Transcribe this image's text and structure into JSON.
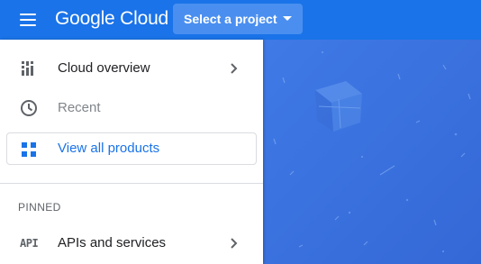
{
  "topbar": {
    "brand_google": "Google",
    "brand_cloud": "Cloud",
    "project_picker_label": "Select a project",
    "background_color": "#1a73e8"
  },
  "sidenav": {
    "items": [
      {
        "label": "Cloud overview",
        "icon": "dashboard-icon",
        "has_chevron": true
      },
      {
        "label": "Recent",
        "icon": "clock-icon",
        "has_chevron": false
      }
    ],
    "view_all": {
      "label": "View all products",
      "icon": "grid-icon"
    },
    "pinned_header": "PINNED",
    "pinned_items": [
      {
        "label": "APIs and services",
        "icon_text": "API",
        "has_chevron": true
      }
    ]
  },
  "colors": {
    "accent": "#1a73e8",
    "hero_background": "#3b74e0",
    "text_primary": "#202124",
    "text_muted": "#80868b"
  }
}
